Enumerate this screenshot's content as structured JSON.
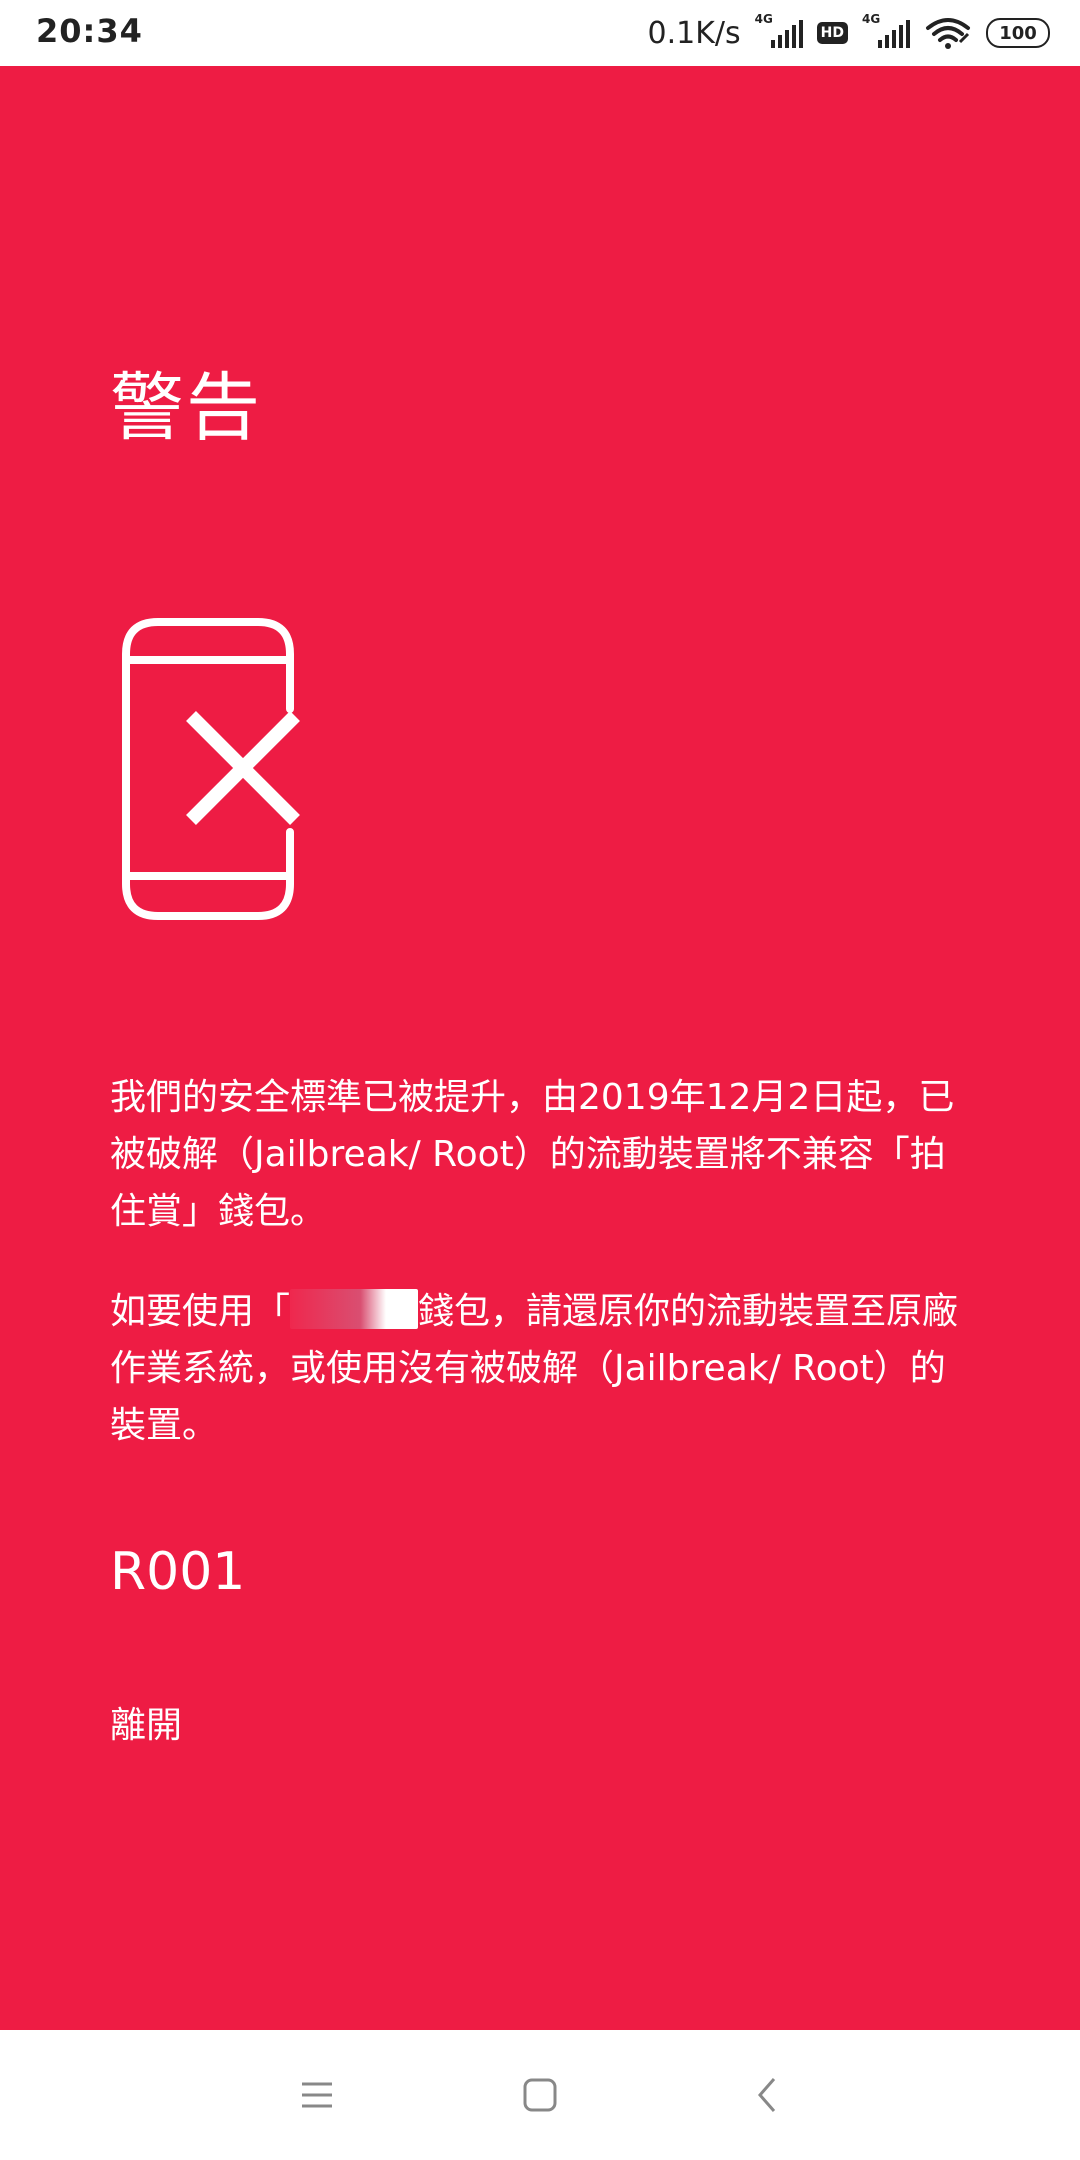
{
  "status_bar": {
    "time": "20:34",
    "network_speed": "0.1K/s",
    "network_type_1": "4G",
    "network_type_2": "4G",
    "hd_label": "HD",
    "battery": "100",
    "icons": [
      "signal-icon",
      "hd-icon",
      "signal-icon",
      "wifi-icon",
      "battery-icon"
    ]
  },
  "warning": {
    "background_color": "#ee1c44",
    "title": "警告",
    "icon": "jailbroken-device-icon",
    "message_1": "我們的安全標準已被提升，由2019年12月2日起，已被破解（Jailbreak/ Root）的流動裝置將不兼容「拍住賞」錢包。",
    "message_2_before": "如要使用「",
    "message_2_after": "錢包，請還原你的流動裝置至原廠作業系統，或使用沒有被破解（Jailbreak/ Root）的裝置。",
    "code": "R001",
    "exit_label": "離開"
  },
  "nav_bar": {
    "icons": [
      "menu-icon",
      "home-icon",
      "back-icon"
    ]
  }
}
